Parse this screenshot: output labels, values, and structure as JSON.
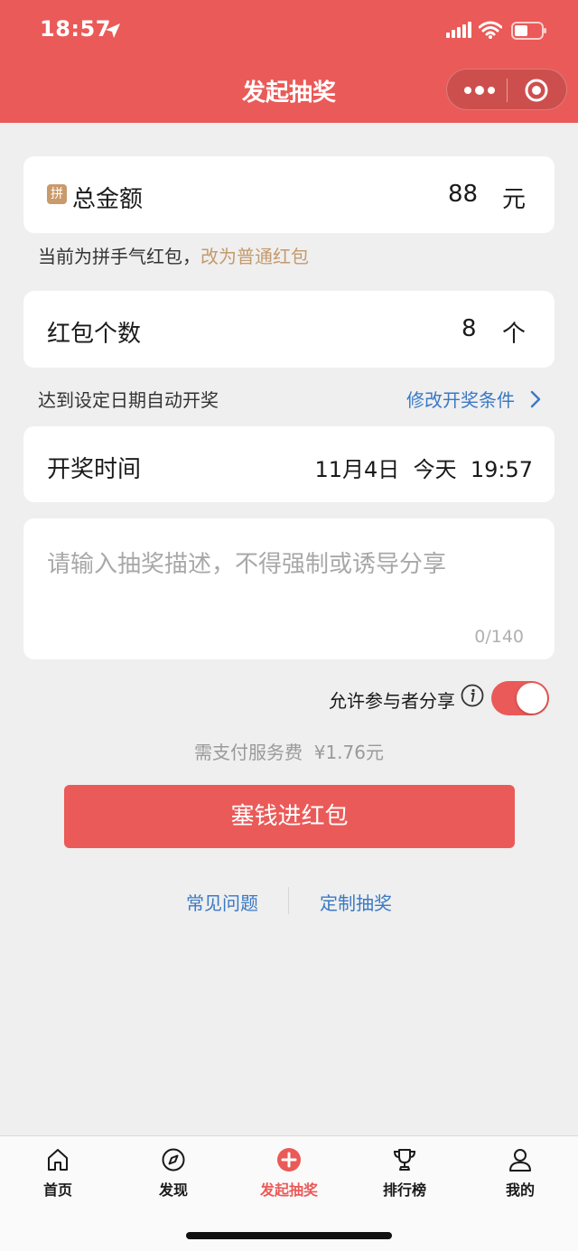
{
  "status_bar": {
    "time": "18:57"
  },
  "nav": {
    "title": "发起抽奖"
  },
  "total_amount": {
    "badge": "拼",
    "label": "总金额",
    "value": "88",
    "unit": "元"
  },
  "packet_hint": {
    "text": "当前为拼手气红包，",
    "link": "改为普通红包"
  },
  "packet_count": {
    "label": "红包个数",
    "value": "8",
    "unit": "个"
  },
  "draw_condition": {
    "text": "达到设定日期自动开奖",
    "link": "修改开奖条件"
  },
  "draw_time": {
    "label": "开奖时间",
    "value": "11月4日  今天  19:57"
  },
  "description": {
    "placeholder": "请输入抽奖描述，不得强制或诱导分享",
    "counter": "0/140"
  },
  "share": {
    "label": "允许参与者分享",
    "enabled": true
  },
  "fee": {
    "text": "需支付服务费  ¥1.76元"
  },
  "submit_button": {
    "label": "塞钱进红包"
  },
  "footer_links": [
    {
      "label": "常见问题"
    },
    {
      "label": "定制抽奖"
    }
  ],
  "tabbar": {
    "items": [
      {
        "label": "首页",
        "icon": "home-icon"
      },
      {
        "label": "发现",
        "icon": "compass-icon"
      },
      {
        "label": "发起抽奖",
        "icon": "plus-circle-icon",
        "active": true
      },
      {
        "label": "排行榜",
        "icon": "trophy-icon"
      },
      {
        "label": "我的",
        "icon": "user-icon"
      }
    ]
  },
  "colors": {
    "brand_red": "#ea5a58",
    "link_gold": "#c49a6c",
    "link_blue": "#3a79c4",
    "background": "#efefef"
  }
}
